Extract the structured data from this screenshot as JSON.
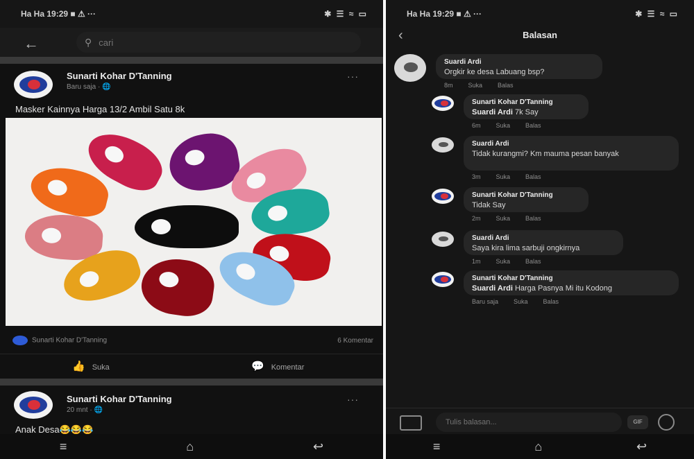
{
  "left": {
    "status": {
      "left": "Ha Ha 19:29 ■ ⚠ ···",
      "right": "✱ ☰ ≈ ▭"
    },
    "search": {
      "back_icon": "back-arrow-icon",
      "placeholder": "cari"
    },
    "post": {
      "author": "Sunarti Kohar D'Tanning",
      "meta": "Baru saja · 🌐",
      "text": "Masker Kainnya Harga 13/2 Ambil Satu 8k",
      "likers": "Sunarti Kohar D'Tanning",
      "comments_count": "6 Komentar",
      "like_label": "Suka",
      "comment_label": "Komentar"
    },
    "post2": {
      "author": "Sunarti Kohar D'Tanning",
      "meta": "20 mnt · 🌐",
      "text": "Anak Desa😂😂😂"
    },
    "nav": [
      "≡",
      "⌂",
      "↩"
    ]
  },
  "right": {
    "status": {
      "left": "Ha Ha 19:29 ■ ⚠ ···",
      "right": "✱ ☰ ≈ ▭"
    },
    "header": {
      "title": "Balasan"
    },
    "replies": [
      {
        "author": "Suardi Ardi",
        "tag": "",
        "text": "Orgkir ke desa Labuang bsp?",
        "time": "8m",
        "like": "Suka",
        "reply": "Balas"
      },
      {
        "author": "Sunarti Kohar D'Tanning",
        "tag": "Suardi Ardi",
        "text": "7k Say",
        "time": "6m",
        "like": "Suka",
        "reply": "Balas"
      },
      {
        "author": "Suardi Ardi",
        "tag": "",
        "text": "Tidak kurangmi? Km mauma pesan banyak",
        "time": "3m",
        "like": "Suka",
        "reply": "Balas"
      },
      {
        "author": "Sunarti Kohar D'Tanning",
        "tag": "",
        "text": "Tidak Say",
        "time": "2m",
        "like": "Suka",
        "reply": "Balas"
      },
      {
        "author": "Suardi Ardi",
        "tag": "",
        "text": "Saya kira lima sarbuji ongkirnya",
        "time": "1m",
        "like": "Suka",
        "reply": "Balas"
      },
      {
        "author": "Sunarti Kohar D'Tanning",
        "tag": "Suardi Ardi",
        "text": "Harga Pasnya Mi itu Kodong",
        "time": "Baru saja",
        "like": "Suka",
        "reply": "Balas"
      }
    ],
    "composer": {
      "placeholder": "Tulis balasan...",
      "gif": "GIF"
    },
    "nav": [
      "≡",
      "⌂",
      "↩"
    ]
  }
}
